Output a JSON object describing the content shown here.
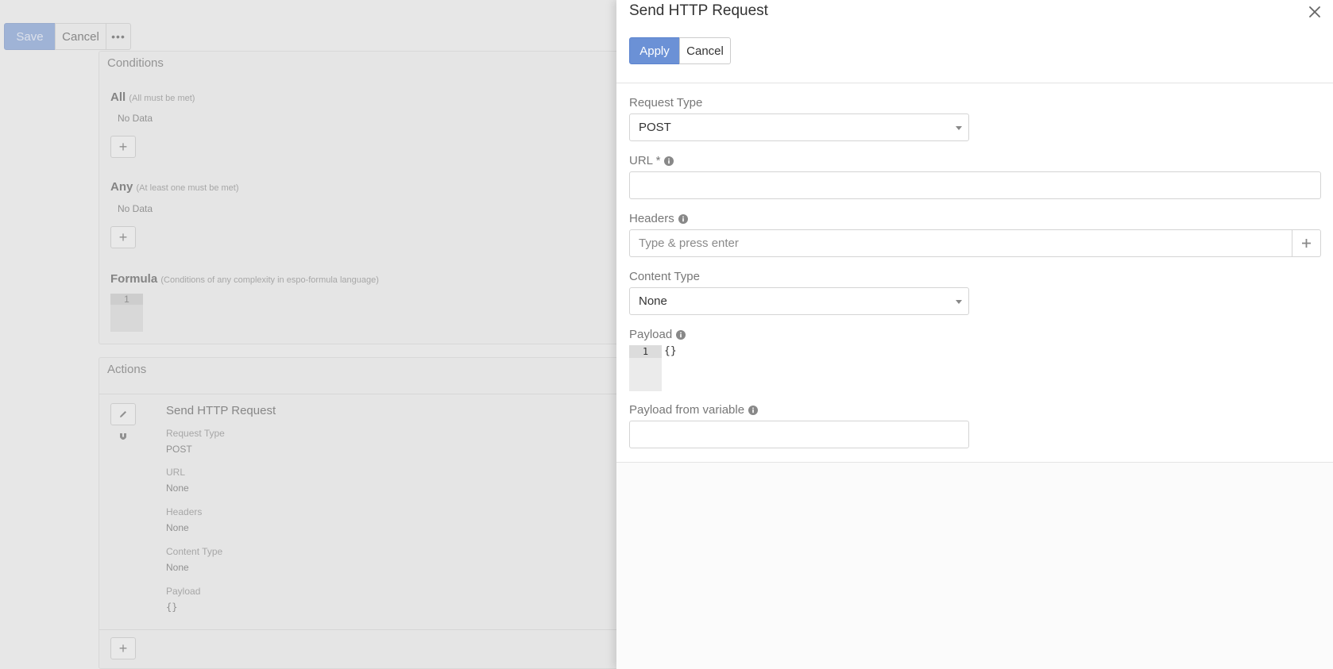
{
  "background": {
    "toolbar": {
      "save_label": "Save",
      "cancel_label": "Cancel",
      "more_label": "•••"
    },
    "conditions": {
      "title": "Conditions",
      "all_label": "All",
      "all_hint": "(All must be met)",
      "all_value": "No Data",
      "any_label": "Any",
      "any_hint": "(At least one must be met)",
      "any_value": "No Data",
      "formula_label": "Formula",
      "formula_hint": "(Conditions of any complexity in espo-formula language)",
      "formula_line": "1"
    },
    "actions": {
      "title": "Actions",
      "action_title": "Send HTTP Request",
      "fields": [
        {
          "label": "Request Type",
          "value": "POST"
        },
        {
          "label": "URL",
          "value": "None"
        },
        {
          "label": "Headers",
          "value": "None"
        },
        {
          "label": "Content Type",
          "value": "None"
        },
        {
          "label": "Payload",
          "value": "{}"
        }
      ]
    }
  },
  "modal": {
    "title": "Send HTTP Request",
    "apply_label": "Apply",
    "cancel_label": "Cancel",
    "fields": {
      "request_type": {
        "label": "Request Type",
        "value": "POST"
      },
      "url": {
        "label": "URL *",
        "value": ""
      },
      "headers": {
        "label": "Headers",
        "placeholder": "Type & press enter"
      },
      "content_type": {
        "label": "Content Type",
        "value": "None"
      },
      "payload": {
        "label": "Payload",
        "line": "1",
        "code": "{}"
      },
      "payload_from_variable": {
        "label": "Payload from variable",
        "value": ""
      }
    }
  },
  "colors": {
    "primary": "#6b91d6",
    "primary_dimmed": "#a8bde2"
  },
  "icons": {
    "close": "close-icon",
    "info": "info-icon",
    "plus": "plus-icon",
    "pencil": "pencil-icon",
    "drag": "drag-handle-icon",
    "caret": "caret-down-icon"
  }
}
